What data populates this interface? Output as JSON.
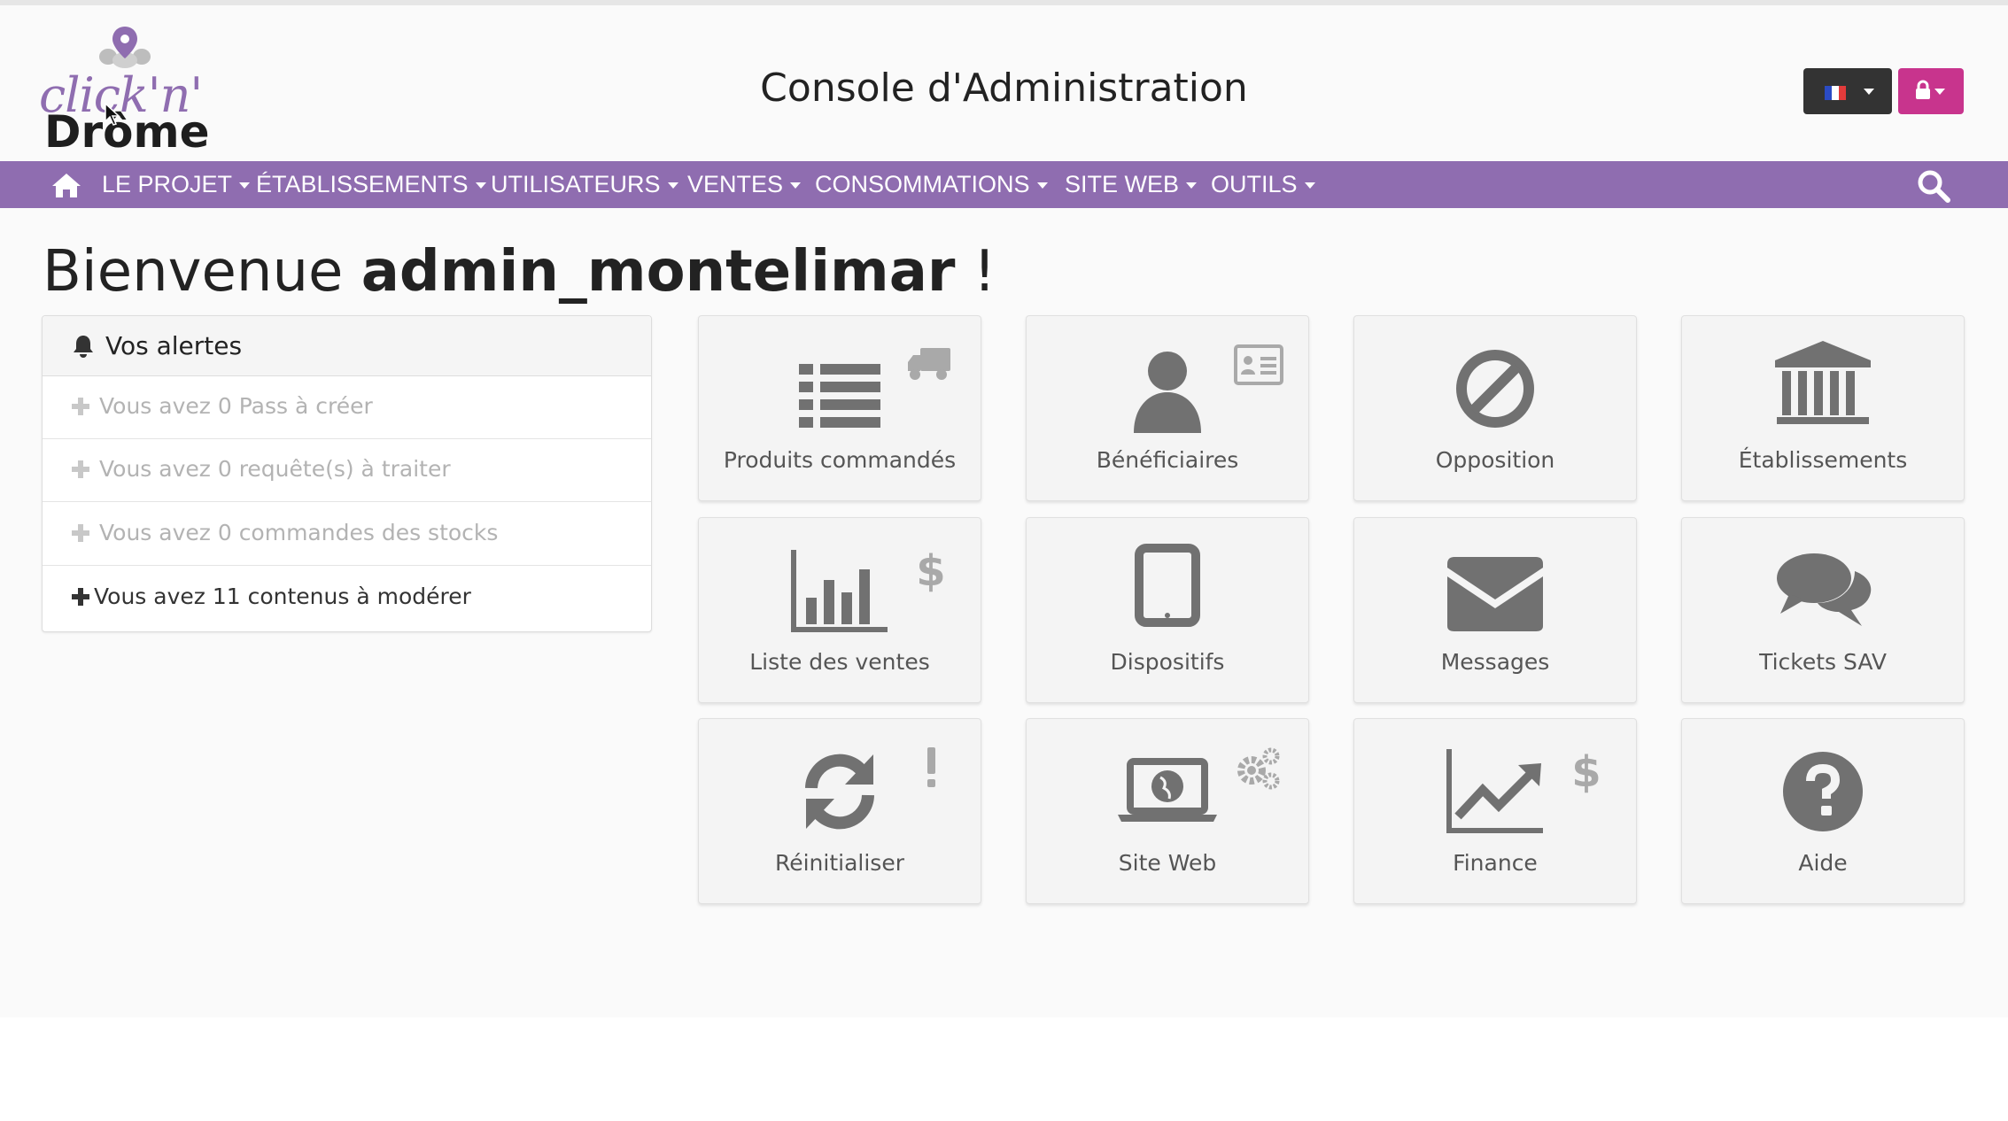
{
  "header": {
    "logo_script": "click'n'",
    "logo_bold": "Drôme",
    "app_title": "Console d'Administration",
    "flag_colors": [
      "#2b4bc4",
      "#ffffff",
      "#e23b3b"
    ],
    "lock_color": "#c8348d"
  },
  "nav": {
    "home_icon": "home-icon",
    "items": [
      {
        "label": "LE PROJET"
      },
      {
        "label": "ÉTABLISSEMENTS"
      },
      {
        "label": "UTILISATEURS"
      },
      {
        "label": "VENTES"
      },
      {
        "label": "CONSOMMATIONS"
      },
      {
        "label": "SITE WEB"
      },
      {
        "label": "OUTILS"
      }
    ],
    "search_icon": "search-icon",
    "color": "#8f6db0"
  },
  "welcome": {
    "prefix": "Bienvenue ",
    "user": "admin_montelimar",
    "suffix": " !"
  },
  "alerts": {
    "title": "Vos alertes",
    "items": [
      {
        "text": "Vous avez 0 Pass à créer"
      },
      {
        "text": "Vous avez 0 requête(s) à traiter"
      },
      {
        "text": "Vous avez 0 commandes des stocks"
      },
      {
        "text": "Vous avez 11 contenus à modérer"
      }
    ]
  },
  "tiles": [
    {
      "label": "Produits commandés",
      "icon": "list-icon",
      "badge": "truck-icon"
    },
    {
      "label": "Bénéficiaires",
      "icon": "user-icon",
      "badge": "id-card-icon"
    },
    {
      "label": "Opposition",
      "icon": "ban-icon",
      "badge": ""
    },
    {
      "label": "Établissements",
      "icon": "bank-icon",
      "badge": ""
    },
    {
      "label": "Liste des ventes",
      "icon": "bar-chart-icon",
      "badge": "dollar-icon"
    },
    {
      "label": "Dispositifs",
      "icon": "tablet-icon",
      "badge": ""
    },
    {
      "label": "Messages",
      "icon": "envelope-icon",
      "badge": ""
    },
    {
      "label": "Tickets SAV",
      "icon": "comments-icon",
      "badge": ""
    },
    {
      "label": "Réinitialiser",
      "icon": "refresh-icon",
      "badge": "exclamation-icon"
    },
    {
      "label": "Site Web",
      "icon": "laptop-globe-icon",
      "badge": "gears-icon"
    },
    {
      "label": "Finance",
      "icon": "line-chart-icon",
      "badge": "dollar-icon"
    },
    {
      "label": "Aide",
      "icon": "question-circle-icon",
      "badge": ""
    }
  ]
}
